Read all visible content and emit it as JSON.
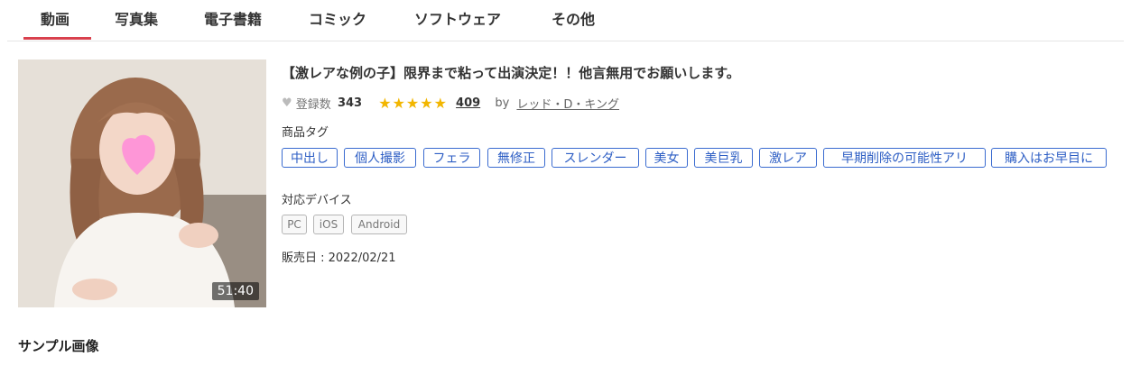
{
  "tabs": [
    {
      "label": "動画",
      "active": true
    },
    {
      "label": "写真集",
      "active": false
    },
    {
      "label": "電子書籍",
      "active": false
    },
    {
      "label": "コミック",
      "active": false
    },
    {
      "label": "ソフトウェア",
      "active": false
    },
    {
      "label": "その他",
      "active": false
    }
  ],
  "product": {
    "thumbnail_duration": "51:40",
    "title": "【激レアな例の子】限界まで粘って出演決定！！他言無用でお願いします。",
    "registrations_label": "登録数",
    "registrations_count": "343",
    "rating_stars": 5,
    "review_count": "409",
    "by_label": "by",
    "author": "レッド・D・キング",
    "tags_label": "商品タグ",
    "tags": [
      "中出し",
      "個人撮影",
      "フェラ",
      "無修正",
      "スレンダー",
      "美女",
      "美巨乳",
      "激レア",
      "早期削除の可能性アリ",
      "購入はお早目に"
    ],
    "devices_label": "対応デバイス",
    "devices": [
      "PC",
      "iOS",
      "Android"
    ],
    "release_date": "販売日 : 2022/02/21"
  },
  "sample_section": {
    "heading": "サンプル画像"
  },
  "colors": {
    "tab_active_underline": "#d9414e",
    "tag_border": "#3a6bd0",
    "star": "#f2b600"
  }
}
